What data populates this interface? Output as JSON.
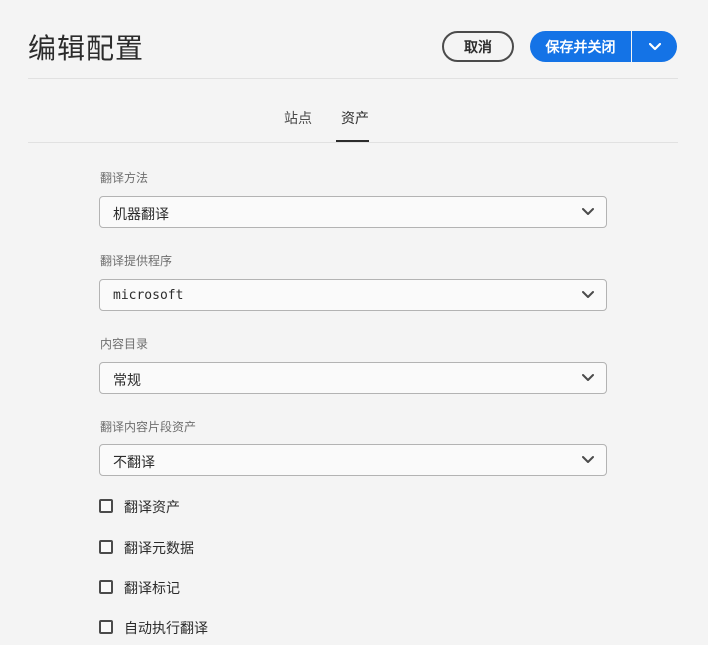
{
  "header": {
    "title": "编辑配置",
    "cancel_label": "取消",
    "save_label": "保存并关闭"
  },
  "tabs": [
    {
      "label": "站点",
      "selected": false
    },
    {
      "label": "资产",
      "selected": true
    }
  ],
  "fields": [
    {
      "label": "翻译方法",
      "value": "机器翻译"
    },
    {
      "label": "翻译提供程序",
      "value": "microsoft"
    },
    {
      "label": "内容目录",
      "value": "常规"
    },
    {
      "label": "翻译内容片段资产",
      "value": "不翻译"
    }
  ],
  "checkboxes": [
    {
      "label": "翻译资产",
      "checked": false
    },
    {
      "label": "翻译元数据",
      "checked": false
    },
    {
      "label": "翻译标记",
      "checked": false
    },
    {
      "label": "自动执行翻译",
      "checked": false
    }
  ],
  "colors": {
    "accent": "#1473e6",
    "background": "#f4f4f4"
  }
}
